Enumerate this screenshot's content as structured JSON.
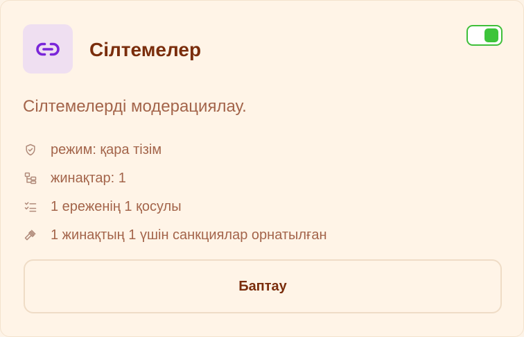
{
  "card": {
    "title": "Сілтемелер",
    "description": "Сілтемелерді модерациялау.",
    "enabled": true,
    "accent_icon_color": "#7a26d9",
    "toggle_color": "#3cc43a",
    "details": [
      {
        "icon": "shield-check-icon",
        "text": "режим: қара тізім"
      },
      {
        "icon": "folder-tree-icon",
        "text": "жинақтар: 1"
      },
      {
        "icon": "checklist-icon",
        "text": "1 ереженің 1 қосулы"
      },
      {
        "icon": "gavel-icon",
        "text": "1 жинақтың 1 үшін санкциялар орнатылған"
      }
    ],
    "configure_label": "Баптау"
  }
}
